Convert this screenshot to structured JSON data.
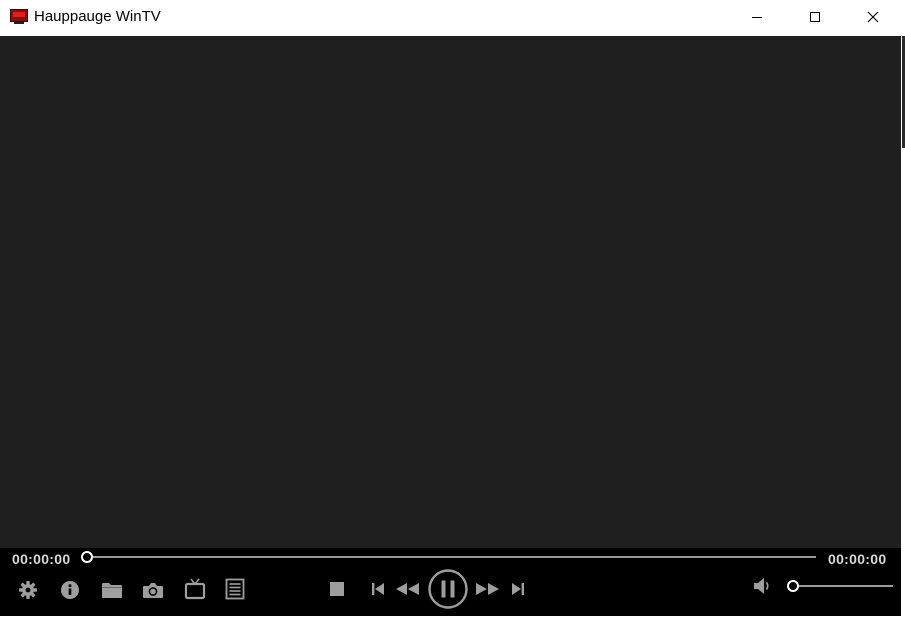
{
  "window": {
    "title": "Hauppauge WinTV"
  },
  "player": {
    "elapsed": "00:00:00",
    "duration": "00:00:00",
    "seek_position": 0,
    "volume_level": 0
  },
  "colors": {
    "video_background": "#1f1f1f",
    "control_bar": "#000000",
    "icon_gray": "#9e9e9e",
    "time_text": "#d8d8d8"
  },
  "icons": {
    "left_tools": [
      "gear-icon",
      "info-icon",
      "folder-icon",
      "camera-icon",
      "tv-icon",
      "list-icon"
    ],
    "transport": [
      "stop-icon",
      "skip-back-icon",
      "rewind-icon",
      "pause-icon",
      "fast-forward-icon",
      "skip-forward-icon"
    ],
    "volume": "speaker-icon"
  }
}
